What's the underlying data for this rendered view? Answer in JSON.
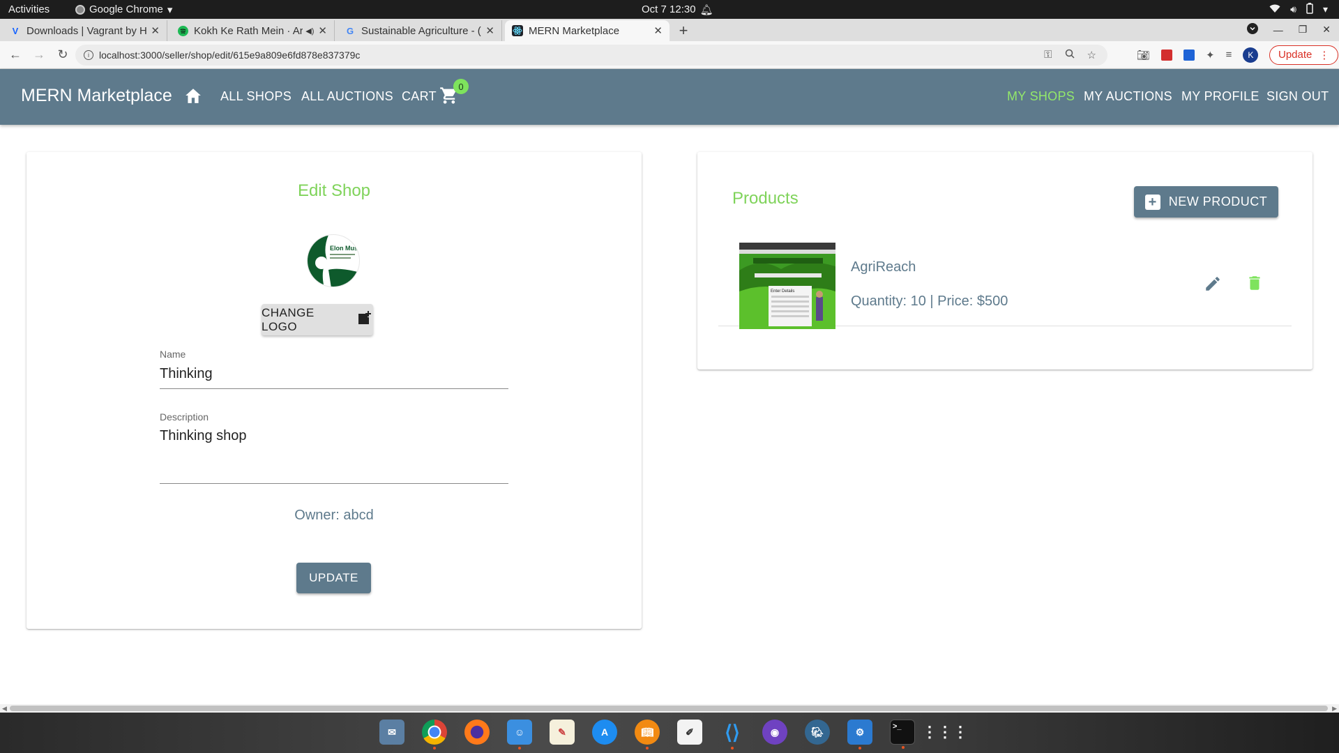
{
  "os": {
    "activities": "Activities",
    "app_name": "Google Chrome",
    "clock": "Oct 7  12:30"
  },
  "browser": {
    "tabs": [
      {
        "title": "Downloads | Vagrant by H",
        "favicon": "V",
        "favicon_color": "#1563ff"
      },
      {
        "title": "Kokh Ke Rath Mein · Ar",
        "favicon": "spotify",
        "favicon_color": "#1db954",
        "muted_icon": "speaker-icon"
      },
      {
        "title": "Sustainable Agriculture - (",
        "favicon": "G",
        "favicon_color": "#4285f4"
      },
      {
        "title": "MERN Marketplace",
        "favicon": "react",
        "favicon_color": "#2a7f8f",
        "active": true
      }
    ],
    "url": "localhost:3000/seller/shop/edit/615e9a809e6fd878e837379c",
    "profile_initial": "K",
    "update_label": "Update"
  },
  "appbar": {
    "brand": "MERN Marketplace",
    "nav": {
      "all_shops": "ALL SHOPS",
      "all_auctions": "ALL AUCTIONS",
      "cart": "CART",
      "cart_count": "0",
      "my_shops": "MY SHOPS",
      "my_auctions": "MY AUCTIONS",
      "my_profile": "MY PROFILE",
      "sign_out": "SIGN OUT"
    },
    "colors": {
      "bar": "#5e7a8c",
      "active": "#93e86b",
      "badge": "#7ee35d"
    }
  },
  "edit_shop": {
    "title": "Edit Shop",
    "logo_caption": "Elon Musk",
    "change_logo_label": "CHANGE LOGO",
    "name_label": "Name",
    "name_value": "Thinking",
    "description_label": "Description",
    "description_value": "Thinking shop",
    "owner_text": "Owner: abcd",
    "update_label": "UPDATE"
  },
  "products": {
    "title": "Products",
    "new_product_label": "NEW PRODUCT",
    "items": [
      {
        "name": "AgriReach",
        "meta": "Quantity: 10 | Price: $500",
        "thumb_caption": "Enter Details"
      }
    ],
    "accent": "#7fd35a"
  },
  "dock": {
    "apps": [
      "mail-icon",
      "chrome-icon",
      "firefox-icon",
      "files-icon",
      "notes-icon",
      "app-store-icon",
      "books-icon",
      "text-editor-icon",
      "vscode-icon",
      "github-icon",
      "postgres-icon",
      "settings-icon",
      "terminal-icon",
      "apps-grid-icon"
    ]
  }
}
